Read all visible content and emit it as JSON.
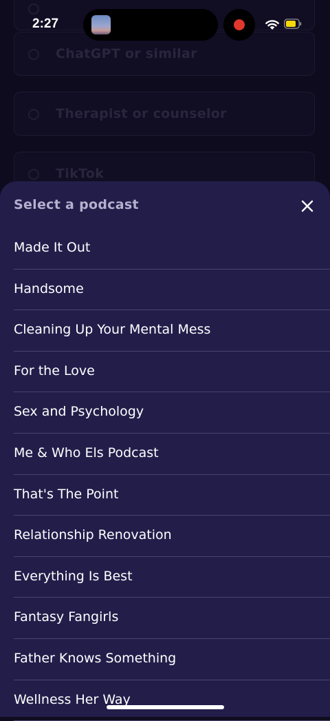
{
  "status_bar": {
    "time": "2:27"
  },
  "background": {
    "options": [
      {
        "label": "ChatGPT or similar"
      },
      {
        "label": "Therapist or counselor"
      },
      {
        "label": "TikTok"
      }
    ]
  },
  "sheet": {
    "title": "Select a podcast",
    "close_icon": "close-icon",
    "items": [
      {
        "label": "Made It Out"
      },
      {
        "label": "Handsome"
      },
      {
        "label": "Cleaning Up Your Mental Mess"
      },
      {
        "label": "For the Love"
      },
      {
        "label": "Sex and Psychology"
      },
      {
        "label": "Me & Who Els Podcast"
      },
      {
        "label": "That's The Point"
      },
      {
        "label": "Relationship Renovation"
      },
      {
        "label": "Everything Is Best"
      },
      {
        "label": "Fantasy Fangirls"
      },
      {
        "label": "Father Knows Something"
      },
      {
        "label": "Wellness Her Way"
      }
    ]
  },
  "colors": {
    "sheet_background": "#231d4a",
    "screen_background": "#13102a",
    "divider": "#4a4470",
    "recording_dot": "#e0382c",
    "battery_fill": "#f5d90a"
  }
}
